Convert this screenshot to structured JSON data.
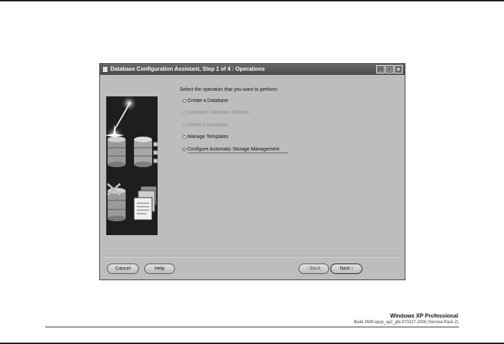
{
  "window": {
    "title": "Database Configuration Assistant, Step 1 of 4 : Operations",
    "minimize_glyph": "_",
    "maximize_glyph": "□",
    "close_glyph": "×"
  },
  "main": {
    "prompt": "Select the operation that you want to perform:",
    "options": [
      {
        "label": "Create a Database",
        "enabled": true,
        "selected": false
      },
      {
        "label": "Configure Database Options",
        "enabled": false,
        "selected": false
      },
      {
        "label": "Delete a Database",
        "enabled": false,
        "selected": false
      },
      {
        "label": "Manage Templates",
        "enabled": true,
        "selected": false
      },
      {
        "label": "Configure Automatic Storage Management",
        "enabled": true,
        "selected": true
      }
    ]
  },
  "buttons": {
    "cancel": "Cancel",
    "help": "Help",
    "back": "Back",
    "next": "Next",
    "back_arrow": "‹",
    "next_arrow": "›"
  },
  "footer": {
    "os_name": "Windows XP Professional",
    "os_build": "Build 2600.xpsp_sp2_qfe.070227-2300 (Service Pack 2)"
  },
  "icons": {
    "app": "oracle-app-icon",
    "art": "database-wand-illustration"
  }
}
